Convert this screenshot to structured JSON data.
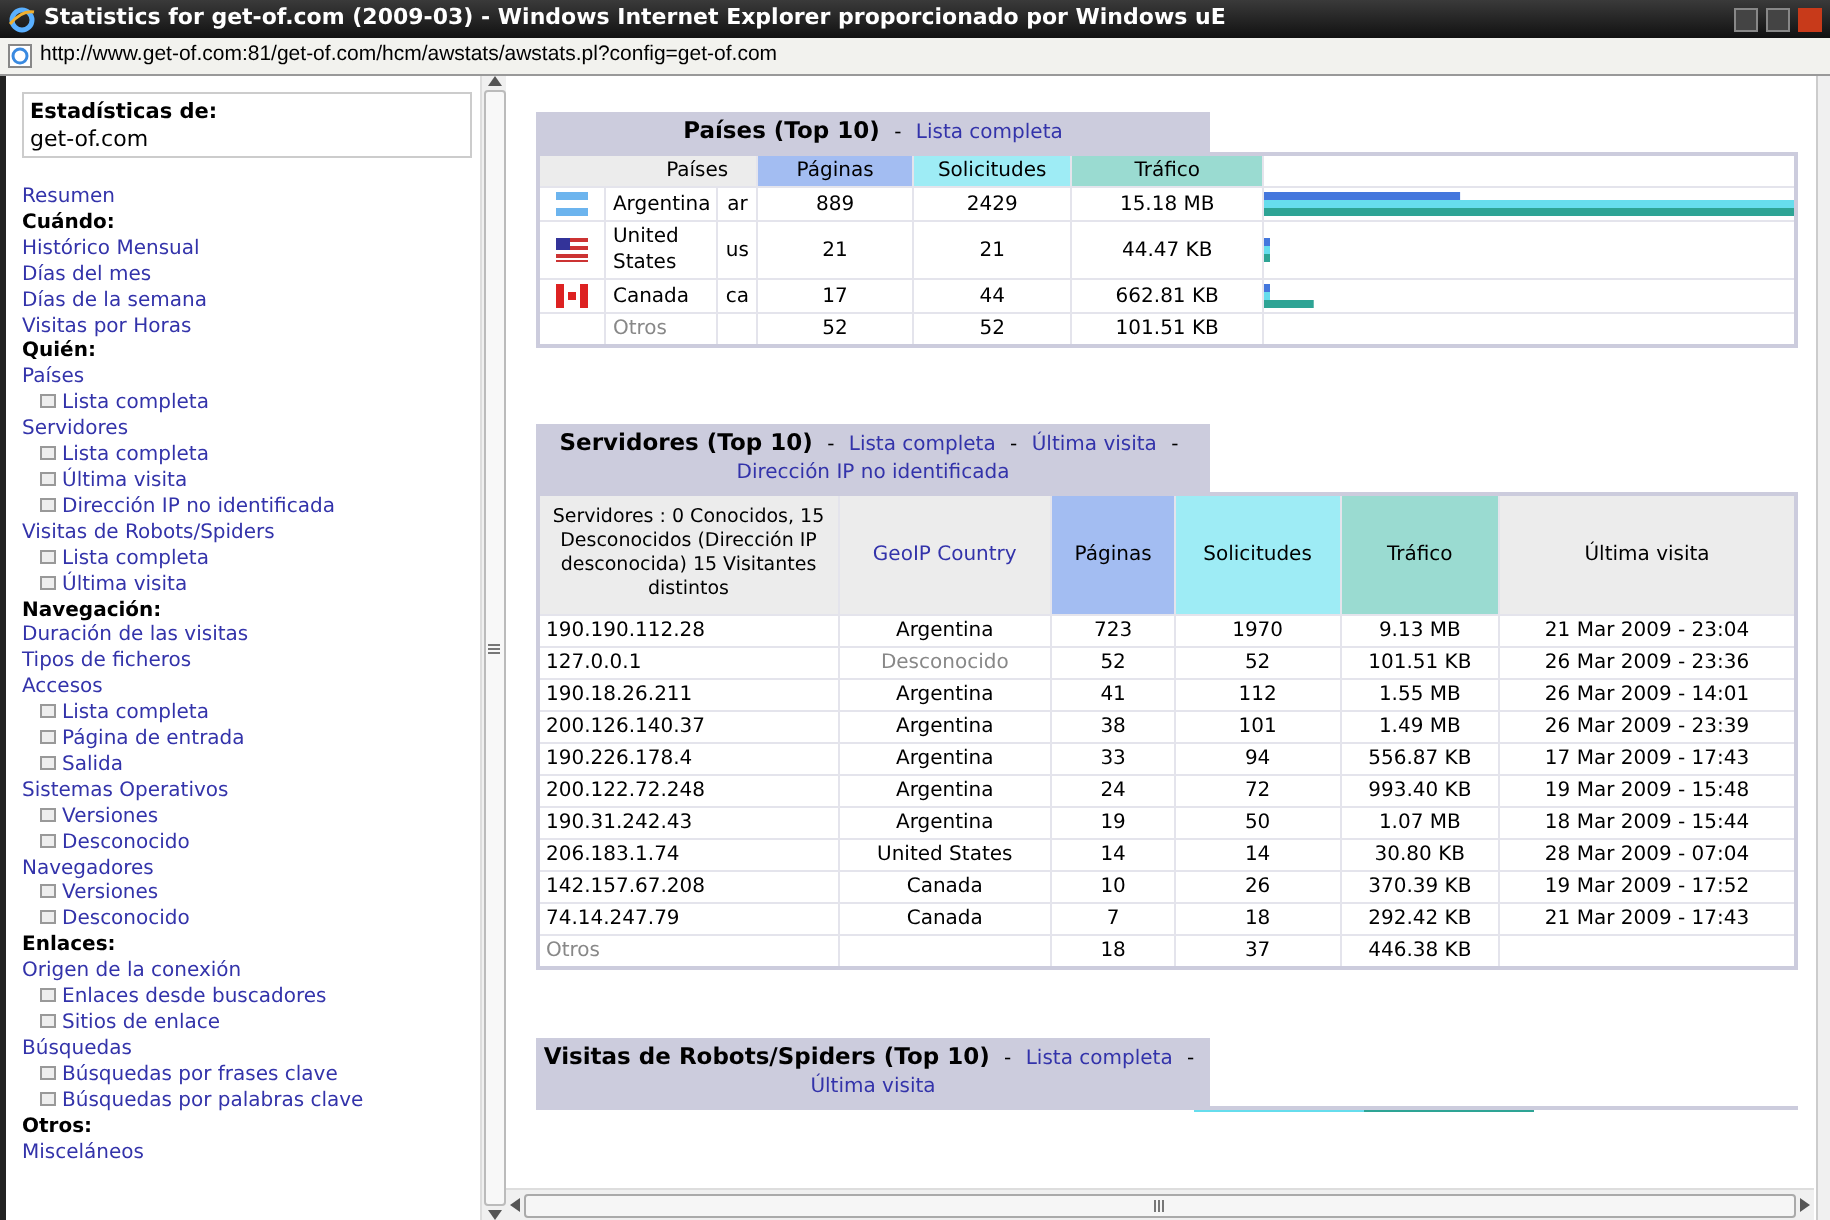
{
  "window": {
    "title": "Statistics for get-of.com (2009-03) - Windows Internet Explorer proporcionado por Windows uE"
  },
  "address_bar": {
    "url": "http://www.get-of.com:81/get-of.com/hcm/awstats/awstats.pl?config=get-of.com"
  },
  "sidebar": {
    "title": "Estadísticas de:",
    "site": "get-of.com",
    "items": [
      {
        "kind": "link",
        "label": "Resumen"
      },
      {
        "kind": "heading",
        "label": "Cuándo:"
      },
      {
        "kind": "link",
        "label": "Histórico Mensual"
      },
      {
        "kind": "link",
        "label": "Días del mes"
      },
      {
        "kind": "link",
        "label": "Días de la semana"
      },
      {
        "kind": "link",
        "label": "Visitas por Horas"
      },
      {
        "kind": "heading",
        "label": "Quién:"
      },
      {
        "kind": "link",
        "label": "Países"
      },
      {
        "kind": "sublink",
        "label": "Lista completa"
      },
      {
        "kind": "link",
        "label": "Servidores"
      },
      {
        "kind": "sublink",
        "label": "Lista completa"
      },
      {
        "kind": "sublink",
        "label": "Última visita"
      },
      {
        "kind": "sublink",
        "label": "Dirección IP no identificada"
      },
      {
        "kind": "link",
        "label": "Visitas de Robots/Spiders"
      },
      {
        "kind": "sublink",
        "label": "Lista completa"
      },
      {
        "kind": "sublink",
        "label": "Última visita"
      },
      {
        "kind": "heading",
        "label": "Navegación:"
      },
      {
        "kind": "link",
        "label": "Duración de las visitas"
      },
      {
        "kind": "link",
        "label": "Tipos de ficheros"
      },
      {
        "kind": "link",
        "label": "Accesos"
      },
      {
        "kind": "sublink",
        "label": "Lista completa"
      },
      {
        "kind": "sublink",
        "label": "Página de entrada"
      },
      {
        "kind": "sublink",
        "label": "Salida"
      },
      {
        "kind": "link",
        "label": "Sistemas Operativos"
      },
      {
        "kind": "sublink",
        "label": "Versiones"
      },
      {
        "kind": "sublink",
        "label": "Desconocido"
      },
      {
        "kind": "link",
        "label": "Navegadores"
      },
      {
        "kind": "sublink",
        "label": "Versiones"
      },
      {
        "kind": "sublink",
        "label": "Desconocido"
      },
      {
        "kind": "heading",
        "label": "Enlaces:"
      },
      {
        "kind": "link",
        "label": "Origen de la conexión"
      },
      {
        "kind": "sublink",
        "label": "Enlaces desde buscadores"
      },
      {
        "kind": "sublink",
        "label": "Sitios de enlace"
      },
      {
        "kind": "link",
        "label": "Búsquedas"
      },
      {
        "kind": "sublink",
        "label": "Búsquedas por frases clave"
      },
      {
        "kind": "sublink",
        "label": "Búsquedas por palabras clave"
      },
      {
        "kind": "heading",
        "label": "Otros:"
      },
      {
        "kind": "link",
        "label": "Misceláneos"
      }
    ]
  },
  "countries": {
    "title": "Países (Top 10)",
    "separator": "-",
    "links": [
      "Lista completa"
    ],
    "columns": [
      "Países",
      "Páginas",
      "Solicitudes",
      "Tráfico"
    ],
    "rows": [
      {
        "kind": "argentina",
        "name": "Argentina",
        "code": "ar",
        "pages": "889",
        "hits": "2429",
        "traffic": "15.18 MB",
        "muted": false
      },
      {
        "kind": "usa",
        "name": "United States",
        "code": "us",
        "pages": "21",
        "hits": "21",
        "traffic": "44.47 KB",
        "muted": false
      },
      {
        "kind": "canada",
        "name": "Canada",
        "code": "ca",
        "pages": "17",
        "hits": "44",
        "traffic": "662.81 KB",
        "muted": false
      },
      {
        "kind": "other",
        "name": "Otros",
        "code": "",
        "pages": "52",
        "hits": "52",
        "traffic": "101.51 KB",
        "muted": true
      }
    ]
  },
  "hosts": {
    "title": "Servidores (Top 10)",
    "separator": "-",
    "links": [
      "Lista completa",
      "Última visita",
      "Dirección IP no identificada"
    ],
    "summary": "Servidores : 0 Conocidos, 15 Desconocidos (Dirección IP desconocida) 15 Visitantes distintos",
    "columns": [
      "GeoIP Country",
      "Páginas",
      "Solicitudes",
      "Tráfico",
      "Última visita"
    ],
    "rows": [
      {
        "host": "190.190.112.28",
        "host_muted": false,
        "country": "Argentina",
        "country_muted": false,
        "pages": "723",
        "hits": "1970",
        "traffic": "9.13 MB",
        "last": "21 Mar 2009 - 23:04"
      },
      {
        "host": "127.0.0.1",
        "host_muted": false,
        "country": "Desconocido",
        "country_muted": true,
        "pages": "52",
        "hits": "52",
        "traffic": "101.51 KB",
        "last": "26 Mar 2009 - 23:36"
      },
      {
        "host": "190.18.26.211",
        "host_muted": false,
        "country": "Argentina",
        "country_muted": false,
        "pages": "41",
        "hits": "112",
        "traffic": "1.55 MB",
        "last": "26 Mar 2009 - 14:01"
      },
      {
        "host": "200.126.140.37",
        "host_muted": false,
        "country": "Argentina",
        "country_muted": false,
        "pages": "38",
        "hits": "101",
        "traffic": "1.49 MB",
        "last": "26 Mar 2009 - 23:39"
      },
      {
        "host": "190.226.178.4",
        "host_muted": false,
        "country": "Argentina",
        "country_muted": false,
        "pages": "33",
        "hits": "94",
        "traffic": "556.87 KB",
        "last": "17 Mar 2009 - 17:43"
      },
      {
        "host": "200.122.72.248",
        "host_muted": false,
        "country": "Argentina",
        "country_muted": false,
        "pages": "24",
        "hits": "72",
        "traffic": "993.40 KB",
        "last": "19 Mar 2009 - 15:48"
      },
      {
        "host": "190.31.242.43",
        "host_muted": false,
        "country": "Argentina",
        "country_muted": false,
        "pages": "19",
        "hits": "50",
        "traffic": "1.07 MB",
        "last": "18 Mar 2009 - 15:44"
      },
      {
        "host": "206.183.1.74",
        "host_muted": false,
        "country": "United States",
        "country_muted": false,
        "pages": "14",
        "hits": "14",
        "traffic": "30.80 KB",
        "last": "28 Mar 2009 - 07:04"
      },
      {
        "host": "142.157.67.208",
        "host_muted": false,
        "country": "Canada",
        "country_muted": false,
        "pages": "10",
        "hits": "26",
        "traffic": "370.39 KB",
        "last": "19 Mar 2009 - 17:52"
      },
      {
        "host": "74.14.247.79",
        "host_muted": false,
        "country": "Canada",
        "country_muted": false,
        "pages": "7",
        "hits": "18",
        "traffic": "292.42 KB",
        "last": "21 Mar 2009 - 17:43"
      },
      {
        "host": "Otros",
        "host_muted": true,
        "country": "",
        "pages": "18",
        "hits": "37",
        "traffic": "446.38 KB",
        "last": ""
      }
    ]
  },
  "robots": {
    "title": "Visitas de Robots/Spiders (Top 10)",
    "separator": "-",
    "links": [
      "Lista completa",
      "Última visita"
    ]
  }
}
